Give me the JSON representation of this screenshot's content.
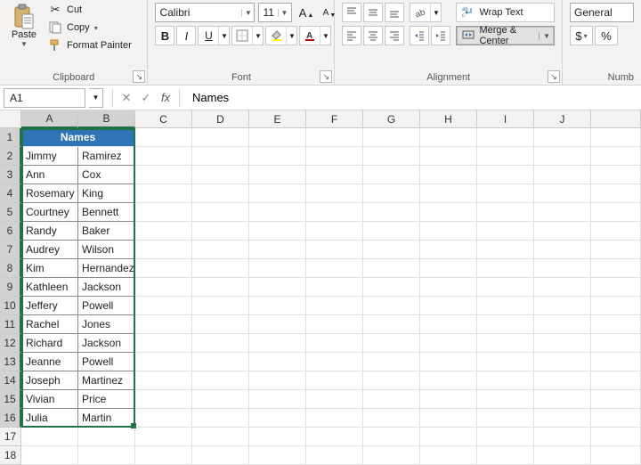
{
  "ribbon": {
    "clipboard": {
      "group_label": "Clipboard",
      "paste": "Paste",
      "cut": "Cut",
      "copy": "Copy",
      "format_painter": "Format Painter"
    },
    "font": {
      "group_label": "Font",
      "font_name": "Calibri",
      "font_size": "11",
      "bold": "B",
      "italic": "I",
      "underline": "U"
    },
    "alignment": {
      "group_label": "Alignment",
      "wrap_text": "Wrap Text",
      "merge_center": "Merge & Center"
    },
    "number": {
      "group_label": "Numb",
      "format": "General",
      "currency": "$",
      "percent": "%"
    }
  },
  "formula_bar": {
    "name_box": "A1",
    "fx": "fx",
    "formula": "Names"
  },
  "sheet": {
    "columns": [
      "A",
      "B",
      "C",
      "D",
      "E",
      "F",
      "G",
      "H",
      "I",
      "J"
    ],
    "selected_cols": [
      "A",
      "B"
    ],
    "row_count": 18,
    "selected_rows_start": 1,
    "selected_rows_end": 16,
    "header_cell": "Names",
    "rows": [
      {
        "a": "Jimmy",
        "b": "Ramirez"
      },
      {
        "a": "Ann",
        "b": "Cox"
      },
      {
        "a": "Rosemary",
        "b": "King"
      },
      {
        "a": "Courtney",
        "b": "Bennett"
      },
      {
        "a": "Randy",
        "b": "Baker"
      },
      {
        "a": "Audrey",
        "b": "Wilson"
      },
      {
        "a": "Kim",
        "b": "Hernandez"
      },
      {
        "a": "Kathleen",
        "b": "Jackson"
      },
      {
        "a": "Jeffery",
        "b": "Powell"
      },
      {
        "a": "Rachel",
        "b": "Jones"
      },
      {
        "a": "Richard",
        "b": "Jackson"
      },
      {
        "a": "Jeanne",
        "b": "Powell"
      },
      {
        "a": "Joseph",
        "b": "Martinez"
      },
      {
        "a": "Vivian",
        "b": "Price"
      },
      {
        "a": "Julia",
        "b": "Martin"
      }
    ]
  }
}
